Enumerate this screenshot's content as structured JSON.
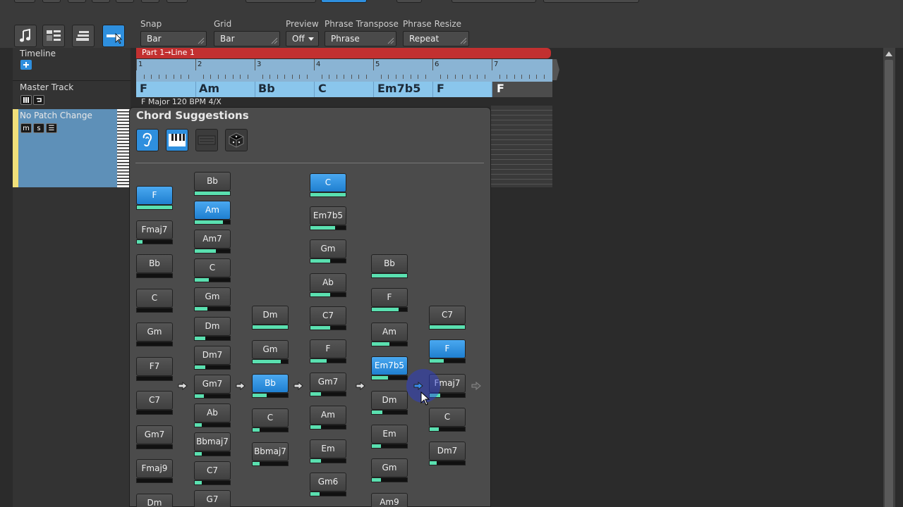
{
  "toolbar": {
    "fields": [
      {
        "label": "Snap",
        "value": "Bar"
      },
      {
        "label": "Grid",
        "value": "Bar"
      },
      {
        "label": "Preview",
        "value": "Off"
      },
      {
        "label": "Phrase Transpose",
        "value": "Phrase"
      },
      {
        "label": "Phrase Resize",
        "value": "Repeat"
      }
    ]
  },
  "left": {
    "timeline_label": "Timeline",
    "master_track_label": "Master Track",
    "track_name": "No Patch Change",
    "track_buttons": [
      "m",
      "s",
      "☰"
    ]
  },
  "timeline": {
    "part_label": "Part 1→Line 1",
    "bars": [
      "1",
      "2",
      "3",
      "4",
      "5",
      "6",
      "7"
    ],
    "chords": [
      "F",
      "Am",
      "Bb",
      "C",
      "Em7b5",
      "F",
      "F"
    ],
    "info": "F Major  120 BPM  4/X"
  },
  "panel": {
    "title": "Chord Suggestions",
    "icons": [
      "ear-icon",
      "piano-icon",
      "keyboard-icon",
      "dice-icon"
    ],
    "columns": [
      [
        {
          "label": "F",
          "score": 1.0,
          "selected": true
        },
        {
          "label": "Fmaj7",
          "score": 0.15
        },
        {
          "label": "Bb",
          "score": 0.0
        },
        {
          "label": "C",
          "score": 0.0
        },
        {
          "label": "Gm",
          "score": 0.0
        },
        {
          "label": "F7",
          "score": 0.0
        },
        {
          "label": "C7",
          "score": 0.0
        },
        {
          "label": "Gm7",
          "score": 0.0
        },
        {
          "label": "Fmaj9",
          "score": 0.0
        },
        {
          "label": "Dm",
          "score": 0.0
        }
      ],
      [
        {
          "label": "Bb",
          "score": 1.0
        },
        {
          "label": "Am",
          "score": 0.8,
          "selected": true
        },
        {
          "label": "Am7",
          "score": 0.6
        },
        {
          "label": "C",
          "score": 0.4
        },
        {
          "label": "Gm",
          "score": 0.35
        },
        {
          "label": "Dm",
          "score": 0.3
        },
        {
          "label": "Dm7",
          "score": 0.3
        },
        {
          "label": "Gm7",
          "score": 0.25
        },
        {
          "label": "Ab",
          "score": 0.2
        },
        {
          "label": "Bbmaj7",
          "score": 0.2
        },
        {
          "label": "C7",
          "score": 0.2
        },
        {
          "label": "G7",
          "score": 0.15
        }
      ],
      [
        {
          "label": "Dm",
          "score": 1.0
        },
        {
          "label": "Gm",
          "score": 0.8
        },
        {
          "label": "Bb",
          "score": 0.4,
          "selected": true
        },
        {
          "label": "C",
          "score": 0.2
        },
        {
          "label": "Bbmaj7",
          "score": 0.2
        }
      ],
      [
        {
          "label": "C",
          "score": 1.0,
          "selected": true
        },
        {
          "label": "Em7b5",
          "score": 0.7
        },
        {
          "label": "Gm",
          "score": 0.55
        },
        {
          "label": "Ab",
          "score": 0.55
        },
        {
          "label": "C7",
          "score": 0.55
        },
        {
          "label": "F",
          "score": 0.45
        },
        {
          "label": "Gm7",
          "score": 0.3
        },
        {
          "label": "Am",
          "score": 0.3
        },
        {
          "label": "Em",
          "score": 0.3
        },
        {
          "label": "Gm6",
          "score": 0.25
        }
      ],
      [
        {
          "label": "Bb",
          "score": 1.0
        },
        {
          "label": "F",
          "score": 0.75
        },
        {
          "label": "Am",
          "score": 0.5
        },
        {
          "label": "Em7b5",
          "score": 0.45,
          "selected": true
        },
        {
          "label": "Dm",
          "score": 0.3
        },
        {
          "label": "Em",
          "score": 0.25
        },
        {
          "label": "Gm",
          "score": 0.25
        },
        {
          "label": "Am9",
          "score": 0.2
        }
      ],
      [
        {
          "label": "C7",
          "score": 1.0
        },
        {
          "label": "F",
          "score": 0.4,
          "selected": true
        },
        {
          "label": "Fmaj7",
          "score": 0.3
        },
        {
          "label": "C",
          "score": 0.25
        },
        {
          "label": "Dm7",
          "score": 0.2
        }
      ]
    ]
  },
  "colors": {
    "accent": "#2e8fde",
    "score_bar": "#5ae0b0",
    "part_bar": "#c23030",
    "chord_track": "#8ac6ec"
  }
}
